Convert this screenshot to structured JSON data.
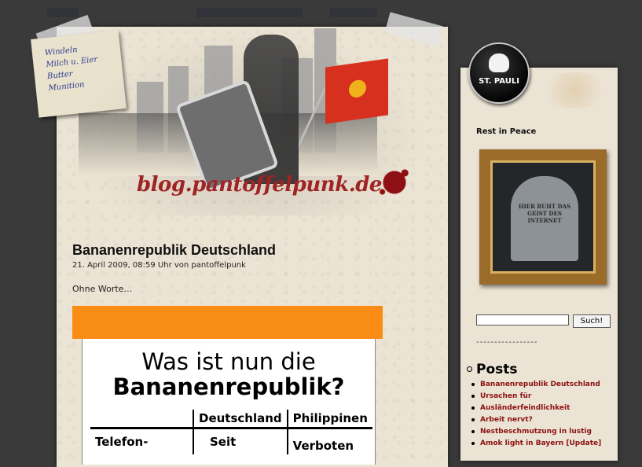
{
  "sticky_note": {
    "lines": [
      "Windeln",
      "Milch u. Eier",
      "Butter",
      "Munition"
    ]
  },
  "header": {
    "blog_name": "blog.pantoffelpunk.de"
  },
  "post": {
    "title": "Bananenrepublik Deutschland",
    "meta": "21. April 2009, 08:59 Uhr von pantoffelpunk",
    "body": "Ohne Worte…",
    "embed": {
      "question_line1": "Was ist nun die",
      "question_line2": "Bananenrepublik?",
      "col1": "Deutschland",
      "col2": "Philippinen",
      "row_label": "Telefon-",
      "row_col1": "Seit",
      "row_col2": "Verboten"
    }
  },
  "sidebar": {
    "badge_label": "ST. PAULI",
    "rip_title": "Rest in Peace",
    "tombstone_text": "HIER RUHT DAS GEIST DES INTERNET",
    "search_button": "Such!",
    "divider": "-----------------",
    "posts_heading": "Posts",
    "posts": [
      "Bananenrepublik Deutschland",
      "Ursachen für",
      "Ausländerfeindlichkeit",
      "Arbeit nervt?",
      "Nestbeschmutzung in lustig",
      "Amok light in Bayern [Update]"
    ]
  }
}
